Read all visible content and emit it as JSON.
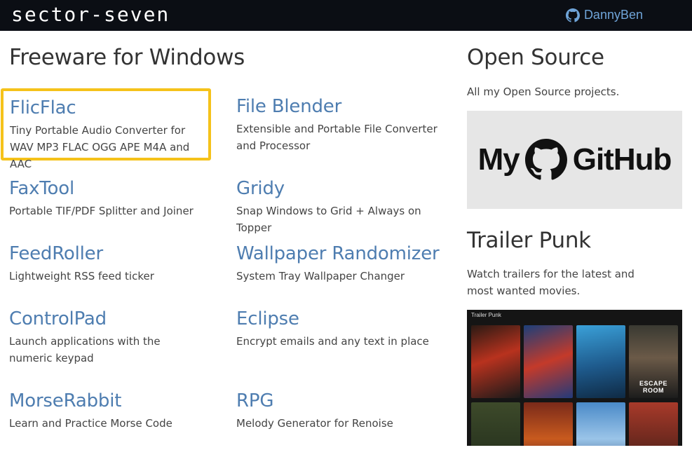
{
  "header": {
    "logo_text": "sector-seven",
    "github_user": "DannyBen"
  },
  "freeware": {
    "title": "Freeware for Windows",
    "apps": [
      {
        "name": "FlicFlac",
        "desc": "Tiny Portable Audio Converter for WAV MP3 FLAC OGG APE M4A and AAC",
        "highlighted": true
      },
      {
        "name": "File Blender",
        "desc": "Extensible and Portable File Converter and Processor"
      },
      {
        "name": "FaxTool",
        "desc": "Portable TIF/PDF Splitter and Joiner"
      },
      {
        "name": "Gridy",
        "desc": "Snap Windows to Grid + Always on Topper"
      },
      {
        "name": "FeedRoller",
        "desc": "Lightweight RSS feed ticker"
      },
      {
        "name": "Wallpaper Randomizer",
        "desc": "System Tray Wallpaper Changer"
      },
      {
        "name": "ControlPad",
        "desc": "Launch applications with the numeric keypad"
      },
      {
        "name": "Eclipse",
        "desc": "Encrypt emails and any text in place"
      },
      {
        "name": "MorseRabbit",
        "desc": "Learn and Practice Morse Code"
      },
      {
        "name": "RPG",
        "desc": "Melody Generator for Renoise"
      }
    ]
  },
  "open_source": {
    "title": "Open Source",
    "desc": "All my Open Source projects.",
    "card_left": "My",
    "card_right": "GitHub"
  },
  "trailer_punk": {
    "title": "Trailer Punk",
    "desc": "Watch trailers for the latest and most wanted movies.",
    "image_header": "Trailer Punk",
    "poster_caption": "ESCAPE ROOM"
  },
  "colors": {
    "topbar": "#0b0e14",
    "link": "#4e7db0",
    "highlight": "#f5c21a"
  }
}
